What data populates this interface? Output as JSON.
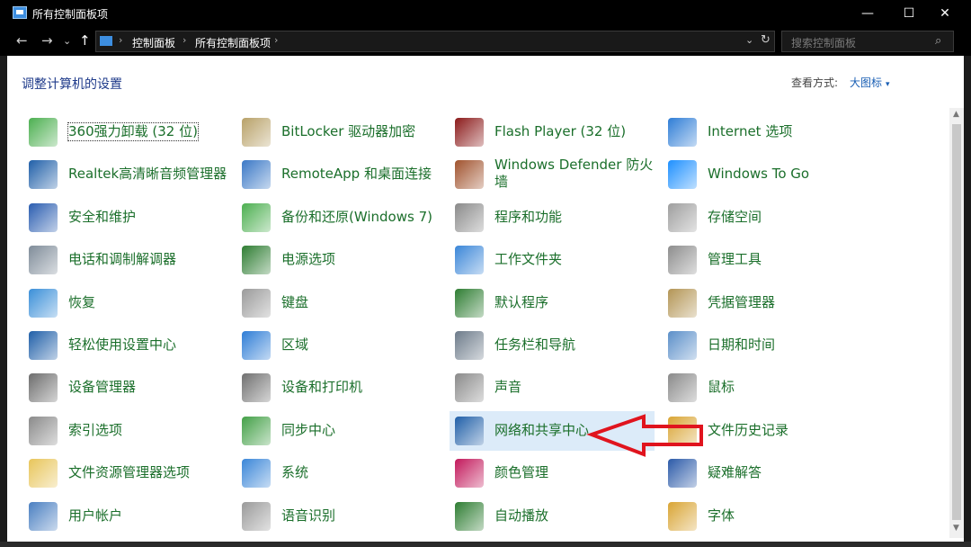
{
  "window": {
    "title": "所有控制面板项",
    "min_symbol": "—",
    "max_symbol": "☐",
    "close_symbol": "✕"
  },
  "nav": {
    "back": "←",
    "forward": "→",
    "recent": "⌄",
    "up": "↑"
  },
  "address": {
    "crumbs": [
      "控制面板",
      "所有控制面板项"
    ],
    "sep": "›",
    "dropdown": "⌄",
    "refresh": "↻"
  },
  "search": {
    "placeholder": "搜索控制面板",
    "icon": "search-icon"
  },
  "header": {
    "title": "调整计算机的设置",
    "view_by_label": "查看方式:",
    "view_by_value": "大图标",
    "caret": "▾"
  },
  "colors": {
    "accent": "#1a5fb4",
    "link_green": "#1b6f2b",
    "selected_bg": "#dcebf9",
    "arrow_red": "#e0141e"
  },
  "items": [
    {
      "label": "360强力卸载 (32 位)",
      "icon": "uninstall-icon",
      "color": "#4caf50",
      "focus": true
    },
    {
      "label": "BitLocker 驱动器加密",
      "icon": "bitlocker-key-icon",
      "color": "#b8a168"
    },
    {
      "label": "Flash Player (32 位)",
      "icon": "flash-icon",
      "color": "#8b1a1a"
    },
    {
      "label": "Internet 选项",
      "icon": "internet-globe-icon",
      "color": "#2e7dd6"
    },
    {
      "label": "Realtek高清晰音频管理器",
      "icon": "realtek-audio-icon",
      "color": "#1f5fa8"
    },
    {
      "label": "RemoteApp 和桌面连接",
      "icon": "remoteapp-icon",
      "color": "#3a78c6"
    },
    {
      "label": "Windows Defender 防火墙",
      "icon": "firewall-icon",
      "color": "#a0522d"
    },
    {
      "label": "Windows To Go",
      "icon": "windows-to-go-icon",
      "color": "#1e90ff"
    },
    {
      "label": "安全和维护",
      "icon": "flag-icon",
      "color": "#2a5db0"
    },
    {
      "label": "备份和还原(Windows 7)",
      "icon": "backup-icon",
      "color": "#4caf50"
    },
    {
      "label": "程序和功能",
      "icon": "programs-icon",
      "color": "#8a8a8a"
    },
    {
      "label": "存储空间",
      "icon": "storage-icon",
      "color": "#9e9e9e"
    },
    {
      "label": "电话和调制解调器",
      "icon": "phone-modem-icon",
      "color": "#7f8c99"
    },
    {
      "label": "电源选项",
      "icon": "power-icon",
      "color": "#2e7d32"
    },
    {
      "label": "工作文件夹",
      "icon": "work-folders-icon",
      "color": "#3a86d8"
    },
    {
      "label": "管理工具",
      "icon": "admin-tools-icon",
      "color": "#8d8d8d"
    },
    {
      "label": "恢复",
      "icon": "recovery-icon",
      "color": "#3a8fd8"
    },
    {
      "label": "键盘",
      "icon": "keyboard-icon",
      "color": "#9a9a9a"
    },
    {
      "label": "默认程序",
      "icon": "default-programs-icon",
      "color": "#2e7d32"
    },
    {
      "label": "凭据管理器",
      "icon": "credential-icon",
      "color": "#b39555"
    },
    {
      "label": "轻松使用设置中心",
      "icon": "ease-of-access-icon",
      "color": "#1f5fa8"
    },
    {
      "label": "区域",
      "icon": "region-icon",
      "color": "#2e7dd6"
    },
    {
      "label": "任务栏和导航",
      "icon": "taskbar-icon",
      "color": "#6d7b8a"
    },
    {
      "label": "日期和时间",
      "icon": "date-time-icon",
      "color": "#5b8fc9"
    },
    {
      "label": "设备管理器",
      "icon": "device-manager-icon",
      "color": "#6d6d6d"
    },
    {
      "label": "设备和打印机",
      "icon": "printer-icon",
      "color": "#707070"
    },
    {
      "label": "声音",
      "icon": "speaker-icon",
      "color": "#8a8a8a"
    },
    {
      "label": "鼠标",
      "icon": "mouse-icon",
      "color": "#8a8a8a"
    },
    {
      "label": "索引选项",
      "icon": "indexing-icon",
      "color": "#8a8a8a"
    },
    {
      "label": "同步中心",
      "icon": "sync-icon",
      "color": "#43a047"
    },
    {
      "label": "网络和共享中心",
      "icon": "network-icon",
      "color": "#1f5fa8",
      "selected": true
    },
    {
      "label": "文件历史记录",
      "icon": "file-history-icon",
      "color": "#d9a534"
    },
    {
      "label": "文件资源管理器选项",
      "icon": "folder-options-icon",
      "color": "#e8c55a"
    },
    {
      "label": "系统",
      "icon": "system-icon",
      "color": "#3a86d8"
    },
    {
      "label": "颜色管理",
      "icon": "color-management-icon",
      "color": "#c2185b"
    },
    {
      "label": "疑难解答",
      "icon": "troubleshoot-icon",
      "color": "#2b5aa8"
    },
    {
      "label": "用户帐户",
      "icon": "user-accounts-icon",
      "color": "#4a7fc1"
    },
    {
      "label": "语音识别",
      "icon": "microphone-icon",
      "color": "#9a9a9a"
    },
    {
      "label": "自动播放",
      "icon": "autoplay-icon",
      "color": "#2e7d32"
    },
    {
      "label": "字体",
      "icon": "fonts-icon",
      "color": "#d9a534"
    }
  ]
}
